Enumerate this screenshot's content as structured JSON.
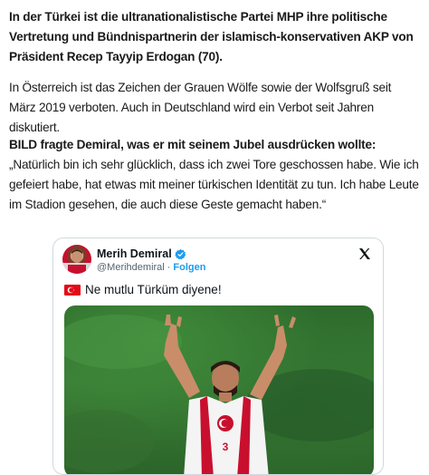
{
  "article": {
    "paragraph1": "In der Türkei ist die ultranationalistische Partei MHP ihre politische Vertretung und Bündnispartnerin der islamisch-konservativen AKP von Präsident Recep Tayyip Erdogan (70).",
    "paragraph2": "In Österreich ist das Zeichen der Grauen Wölfe sowie der Wolfsgruß seit März 2019 verboten. Auch in Deutschland wird ein Verbot seit Jahren diskutiert.",
    "paragraph3_lead": "BILD fragte Demiral, was er mit seinem Jubel ausdrücken wollte:",
    "paragraph3_quote": " „Natürlich bin ich sehr glücklich, dass ich zwei Tore geschossen habe. Wie ich gefeiert habe, hat etwas mit meiner türkischen Identität zu tun. Ich habe Leute im Stadion gesehen, die auch diese Geste gemacht haben.“"
  },
  "tweet": {
    "name": "Merih Demiral",
    "handle": "@Merihdemiral",
    "separator": "·",
    "follow_label": "Folgen",
    "text": "Ne mutlu Türküm diyene!",
    "jersey_number": "3",
    "icons": {
      "verified": "verified-badge-icon",
      "x_logo": "x-logo-icon",
      "flag": "turkey-flag-emoji"
    },
    "colors": {
      "verified": "#1d9bf0",
      "follow": "#1d9bf0",
      "handle": "#536471",
      "border": "#cfd9de"
    }
  }
}
